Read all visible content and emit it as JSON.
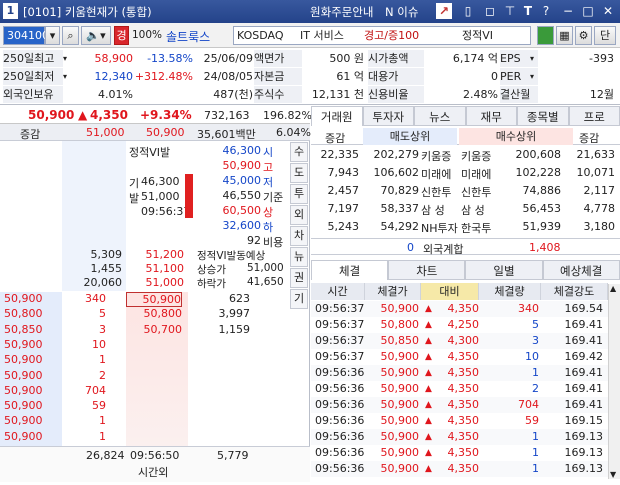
{
  "title": {
    "winnum": "1",
    "text": "[0101] 키움현재가 (통합)",
    "notice": "원화주문안내",
    "issue": "N 이슈"
  },
  "toolbar": {
    "code": "304100",
    "lock": "경",
    "ratio": "100%",
    "name": "솔트룩스",
    "market": "KOSDAQ",
    "sector": "IT 서비스",
    "warn": "경고/증100",
    "vi": "정적VI",
    "dan": "단"
  },
  "info": [
    {
      "l1": "250일최고",
      "v1": "58,900",
      "p1": "-13.58%",
      "d1": "25/06/09",
      "l2": "액면가",
      "v2": "500 원",
      "l3": "시가총액",
      "v3": "6,174 억",
      "l4": "EPS",
      "v4": "-393"
    },
    {
      "l1": "250일최저",
      "v1": "12,340",
      "p1": "+312.48%",
      "d1": "24/08/05",
      "l2": "자본금",
      "v2": "61 억",
      "l3": "대용가",
      "v3": "0",
      "l4": "PER",
      "v4": ""
    },
    {
      "l1": "외국인보유",
      "v1": "4.01%",
      "p1": "",
      "d1": "487(천)",
      "l2": "주식수",
      "v2": "12,131 천",
      "l3": "신용비율",
      "v3": "2.48%",
      "l4": "결산월",
      "v4": "12월"
    }
  ],
  "price": {
    "current": "50,900",
    "change": "4,350",
    "rate": "+9.34%",
    "volume": "732,163",
    "vr": "196.82%"
  },
  "ob_header": {
    "label": "증감",
    "v1": "51,000",
    "v2": "50,900",
    "amt": "35,601백만",
    "pct": "6.04%"
  },
  "vi_panel": {
    "title": "정적VI발",
    "rows": [
      [
        "기",
        "46,300"
      ],
      [
        "발",
        "51,000"
      ],
      [
        "",
        "09:56:37"
      ]
    ],
    "side": [
      [
        "46,300",
        "시"
      ],
      [
        "50,900",
        "고"
      ],
      [
        "45,000",
        "저"
      ],
      [
        "46,550",
        "기준"
      ],
      [
        "60,500",
        "상"
      ],
      [
        "32,600",
        "하"
      ],
      [
        "92",
        "비용"
      ]
    ]
  },
  "side_tabs": [
    "수",
    "도",
    "투",
    "외",
    "차",
    "뉴",
    "권",
    "기"
  ],
  "asks": [
    [
      "5,309",
      "51,200"
    ],
    [
      "1,455",
      "51,100"
    ],
    [
      "20,060",
      "51,000"
    ]
  ],
  "vi_expect": {
    "title": "정적VI발동예상",
    "up_l": "상승가",
    "up_v": "51,000",
    "dn_l": "하락가",
    "dn_v": "41,650"
  },
  "trades_left": [
    [
      "50,900",
      "340"
    ],
    [
      "50,800",
      "5"
    ],
    [
      "50,850",
      "3"
    ],
    [
      "50,900",
      "10"
    ],
    [
      "50,900",
      "1"
    ],
    [
      "50,900",
      "2"
    ],
    [
      "50,900",
      "704"
    ],
    [
      "50,900",
      "59"
    ],
    [
      "50,900",
      "1"
    ],
    [
      "50,900",
      "1"
    ]
  ],
  "bids": [
    [
      "50,900",
      "623"
    ],
    [
      "50,800",
      "3,997"
    ],
    [
      "50,700",
      "1,159"
    ]
  ],
  "bottom": {
    "total_l": "26,824",
    "time": "09:56:50",
    "total_r": "5,779",
    "after": "시간외"
  },
  "right_tabs": [
    "거래원",
    "투자자",
    "뉴스",
    "재무",
    "종목별",
    "프로"
  ],
  "broker_hdr": {
    "c1": "증감",
    "c2": "매도상위",
    "c3": "매수상위",
    "c4": "증감"
  },
  "brokers": [
    [
      "22,335",
      "202,279",
      "키움증",
      "키움증",
      "200,608",
      "21,633"
    ],
    [
      "7,943",
      "106,602",
      "미래에",
      "미래에",
      "102,228",
      "10,071"
    ],
    [
      "2,457",
      "70,829",
      "신한투",
      "신한투",
      "74,886",
      "2,117"
    ],
    [
      "7,197",
      "58,337",
      "삼 성",
      "삼 성",
      "56,453",
      "4,778"
    ],
    [
      "5,243",
      "54,292",
      "NH투자",
      "한국투",
      "51,939",
      "3,180"
    ]
  ],
  "foreign": {
    "l": "0",
    "label": "외국계합",
    "r": "1,408"
  },
  "trade_tabs": [
    "체결",
    "차트",
    "일별",
    "예상체결"
  ],
  "trade_hdr": [
    "시간",
    "체결가",
    "대비",
    "체결량",
    "체결강도"
  ],
  "trades": [
    [
      "09:56:37",
      "50,900",
      "4,350",
      "340",
      "169.54"
    ],
    [
      "09:56:37",
      "50,800",
      "4,250",
      "5",
      "169.41"
    ],
    [
      "09:56:37",
      "50,850",
      "4,300",
      "3",
      "169.41"
    ],
    [
      "09:56:37",
      "50,900",
      "4,350",
      "10",
      "169.42"
    ],
    [
      "09:56:36",
      "50,900",
      "4,350",
      "1",
      "169.41"
    ],
    [
      "09:56:36",
      "50,900",
      "4,350",
      "2",
      "169.41"
    ],
    [
      "09:56:36",
      "50,900",
      "4,350",
      "704",
      "169.41"
    ],
    [
      "09:56:36",
      "50,900",
      "4,350",
      "59",
      "169.15"
    ],
    [
      "09:56:36",
      "50,900",
      "4,350",
      "1",
      "169.13"
    ],
    [
      "09:56:36",
      "50,900",
      "4,350",
      "1",
      "169.13"
    ],
    [
      "09:56:36",
      "50,900",
      "4,350",
      "1",
      "169.13"
    ]
  ]
}
